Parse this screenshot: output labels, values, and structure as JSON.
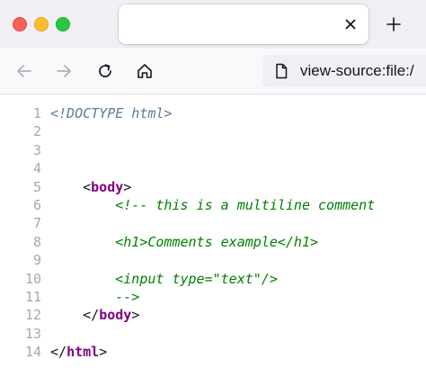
{
  "browser": {
    "tab": {
      "title": ""
    },
    "newtab_label": "+",
    "url": "view-source:file:/"
  },
  "colors": {
    "tag": "#800080",
    "comment": "#008000",
    "doctype": "#5f7a96",
    "line_number": "#a8a8a8"
  },
  "icons": [
    "close-icon",
    "plus-icon",
    "back-arrow-icon",
    "forward-arrow-icon",
    "reload-icon",
    "home-icon",
    "page-icon"
  ],
  "source": {
    "lines": [
      {
        "n": "1",
        "indent": "",
        "parts": [
          [
            "doctype",
            "<!DOCTYPE html>"
          ]
        ]
      },
      {
        "n": "2",
        "indent": "",
        "parts": []
      },
      {
        "n": "3",
        "indent": "",
        "parts": []
      },
      {
        "n": "4",
        "indent": "",
        "parts": []
      },
      {
        "n": "5",
        "indent": "    ",
        "parts": [
          [
            "plain",
            "<"
          ],
          [
            "tag",
            "body"
          ],
          [
            "plain",
            ">"
          ]
        ]
      },
      {
        "n": "6",
        "indent": "        ",
        "parts": [
          [
            "comment",
            "<!-- this is a multiline comment"
          ]
        ]
      },
      {
        "n": "7",
        "indent": "",
        "parts": []
      },
      {
        "n": "8",
        "indent": "        ",
        "parts": [
          [
            "comment",
            "<h1>Comments example</h1>"
          ]
        ]
      },
      {
        "n": "9",
        "indent": "",
        "parts": []
      },
      {
        "n": "10",
        "indent": "        ",
        "parts": [
          [
            "comment",
            "<input type=\"text\"/>"
          ]
        ]
      },
      {
        "n": "11",
        "indent": "        ",
        "parts": [
          [
            "comment",
            "-->"
          ]
        ]
      },
      {
        "n": "12",
        "indent": "    ",
        "parts": [
          [
            "plain",
            "</"
          ],
          [
            "tag",
            "body"
          ],
          [
            "plain",
            ">"
          ]
        ]
      },
      {
        "n": "13",
        "indent": "",
        "parts": []
      },
      {
        "n": "14",
        "indent": "",
        "parts": [
          [
            "plain",
            "</"
          ],
          [
            "tag",
            "html"
          ],
          [
            "plain",
            ">"
          ]
        ]
      }
    ]
  }
}
